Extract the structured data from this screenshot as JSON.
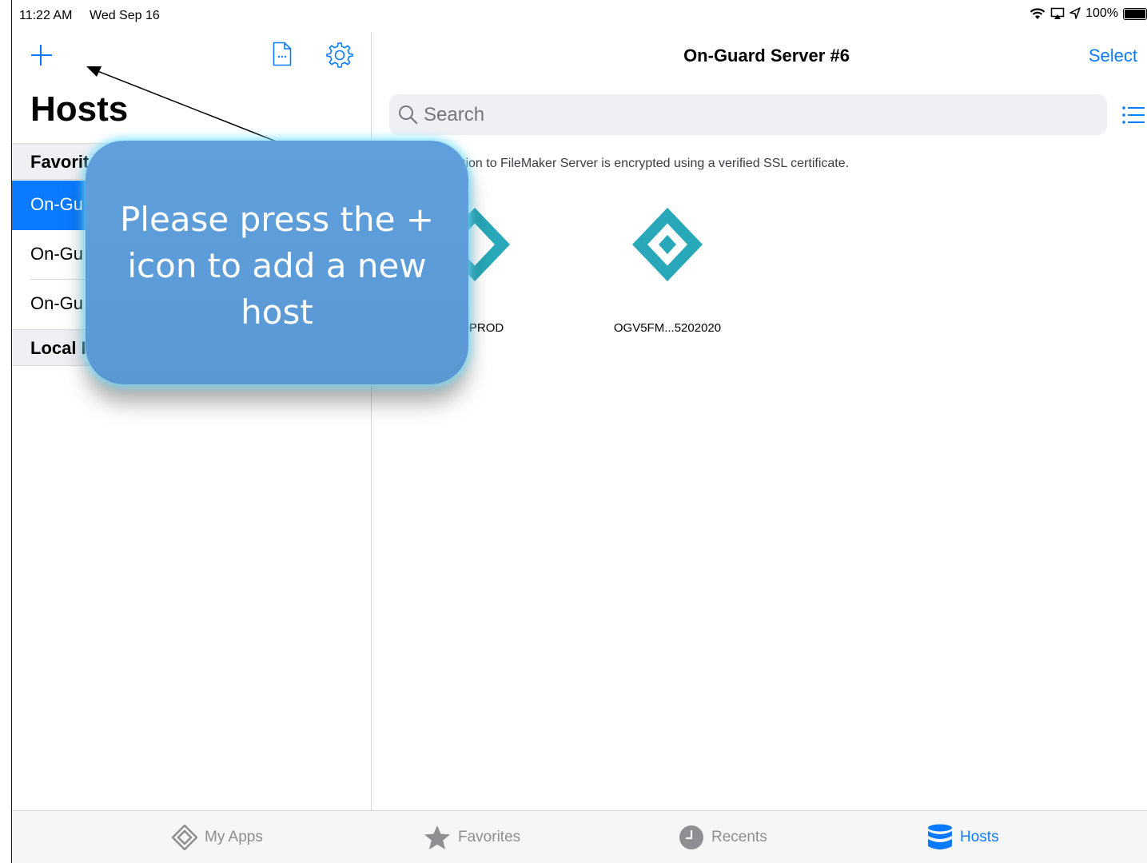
{
  "status_bar": {
    "time": "11:22 AM",
    "date": "Wed Sep 16",
    "battery": "100%"
  },
  "sidebar": {
    "title": "Hosts",
    "sections": [
      {
        "header": "Favorit"
      },
      {
        "header": "Local I"
      }
    ],
    "hosts": [
      "On-Gu",
      "On-Gu",
      "On-Gu"
    ]
  },
  "main": {
    "title": "On-Guard Server #6",
    "select_label": "Select",
    "search_placeholder": "Search",
    "ssl_note": "tion to FileMaker Server is encrypted using a verified SSL certificate.",
    "files": [
      "...20PROD",
      "OGV5FM...5202020"
    ]
  },
  "tabbar": {
    "tabs": [
      "My Apps",
      "Favorites",
      "Recents",
      "Hosts"
    ],
    "active": "Hosts"
  },
  "callout": {
    "text": "Please press the + icon to add a new host"
  },
  "colors": {
    "accent": "#0a7aff",
    "file_icon": "#28a8b8",
    "callout": "#5b9bd5",
    "callout_glow": "#6fe0ff"
  }
}
